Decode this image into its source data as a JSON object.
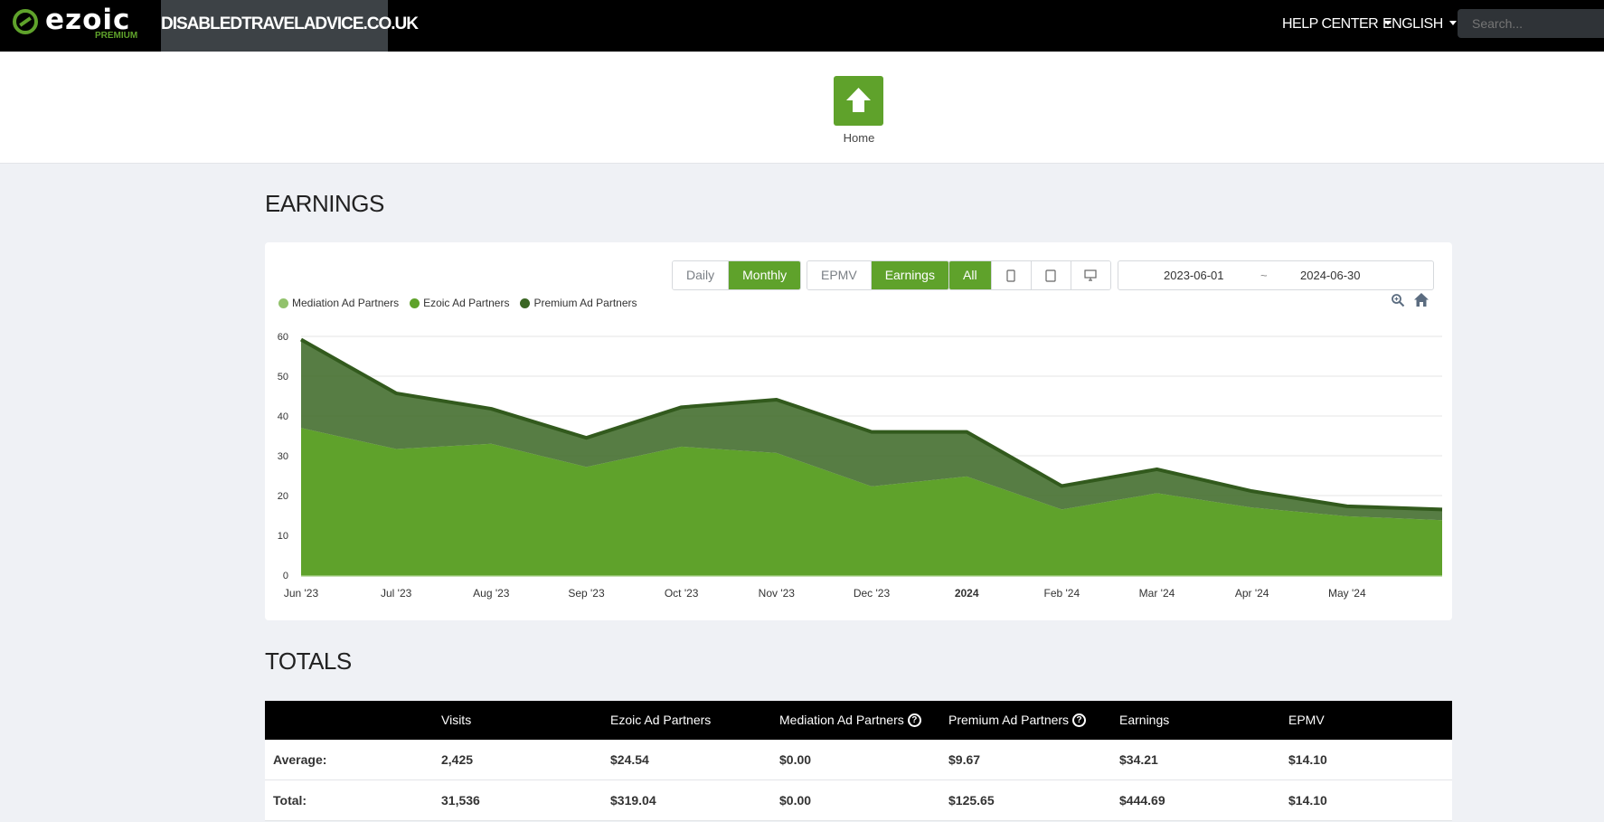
{
  "topbar": {
    "logo_text": "ezoic",
    "logo_sub": "PREMIUM",
    "site_name": "DISABLEDTRAVELADVICE.CO.UK",
    "help_center": "HELP CENTER",
    "language": "ENGLISH",
    "search_placeholder": "Search..."
  },
  "home": {
    "label": "Home",
    "icon": "home-icon"
  },
  "earnings": {
    "title": "EARNINGS",
    "period_buttons": [
      {
        "label": "Daily",
        "active": false
      },
      {
        "label": "Monthly",
        "active": true
      }
    ],
    "metric_buttons": [
      {
        "label": "EPMV",
        "active": false
      },
      {
        "label": "Earnings",
        "active": true
      }
    ],
    "device_buttons": [
      {
        "label": "All",
        "active": true
      },
      {
        "icon": "mobile-icon"
      },
      {
        "icon": "tablet-icon"
      },
      {
        "icon": "desktop-icon"
      }
    ],
    "date_start": "2023-06-01",
    "date_separator": "~",
    "date_end": "2024-06-30",
    "zoom_icon": "zoom-icon",
    "reset_icon": "home-icon"
  },
  "chart_data": {
    "type": "area",
    "stacked": true,
    "x_labels": [
      "Jun '23",
      "Jul '23",
      "Aug '23",
      "Sep '23",
      "Oct '23",
      "Nov '23",
      "Dec '23",
      "2024",
      "Feb '24",
      "Mar '24",
      "Apr '24",
      "May '24",
      ""
    ],
    "x_label_bold": [
      false,
      false,
      false,
      false,
      false,
      false,
      false,
      true,
      false,
      false,
      false,
      false,
      false
    ],
    "y_ticks": [
      0,
      10,
      20,
      30,
      40,
      50,
      60
    ],
    "ylim": [
      0,
      60
    ],
    "grid": true,
    "legend_position": "top-left",
    "series": [
      {
        "name": "Mediation Ad Partners",
        "color": "#92c26c",
        "values": [
          0,
          0,
          0,
          0,
          0,
          0,
          0,
          0,
          0,
          0,
          0,
          0,
          0
        ]
      },
      {
        "name": "Ezoic Ad Partners",
        "color": "#5fa22b",
        "values": [
          37,
          31.7,
          33,
          27.2,
          32.3,
          30.7,
          22.3,
          24.8,
          16.5,
          20.6,
          17,
          14.8,
          13.8
        ]
      },
      {
        "name": "Premium Ad Partners",
        "color": "#3a6623",
        "values": [
          22.2,
          14,
          8.8,
          7.3,
          9.9,
          13.4,
          13.7,
          11.2,
          5.9,
          6,
          4.1,
          2.5,
          2.7
        ]
      }
    ]
  },
  "totals": {
    "title": "TOTALS",
    "headers": [
      "",
      "Visits",
      "Ezoic Ad Partners",
      "Mediation Ad Partners",
      "Premium Ad Partners",
      "Earnings",
      "EPMV"
    ],
    "help_icon_cols": [
      3,
      4
    ],
    "help_icon_glyph": "?",
    "rows": [
      [
        "Average:",
        "2,425",
        "$24.54",
        "$0.00",
        "$9.67",
        "$34.21",
        "$14.10"
      ],
      [
        "Total:",
        "31,536",
        "$319.04",
        "$0.00",
        "$125.65",
        "$444.69",
        "$14.10"
      ]
    ]
  }
}
